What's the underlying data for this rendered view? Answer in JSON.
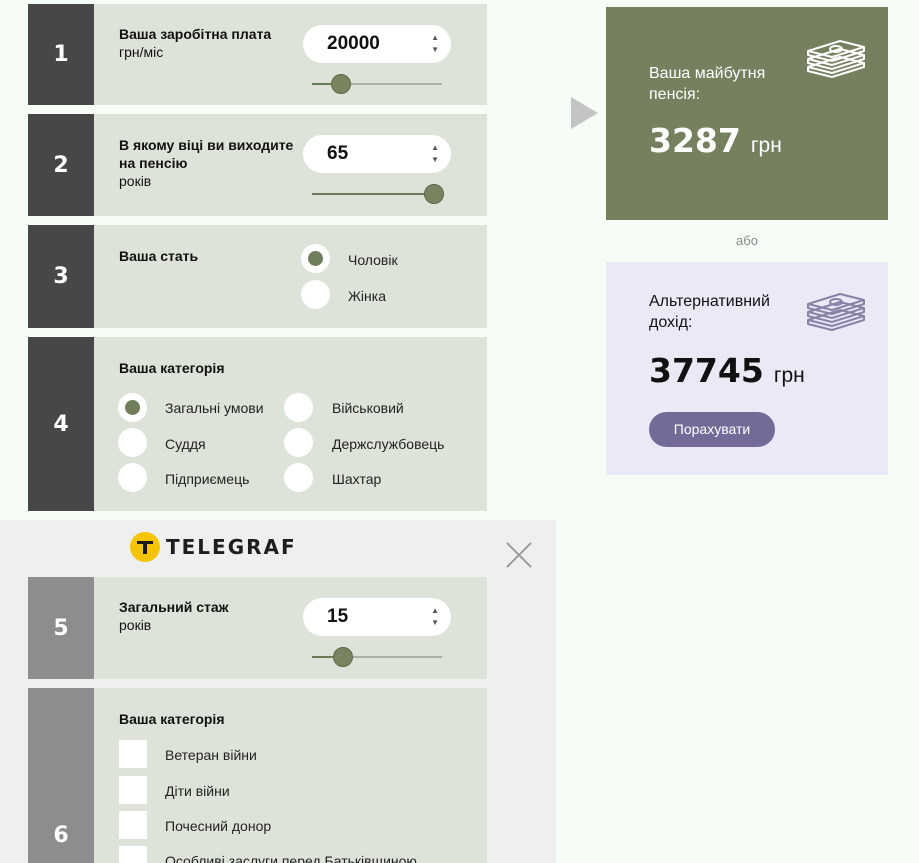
{
  "step1": {
    "num": "1",
    "title": "Ваша заробітна плата",
    "sub": "грн/міс",
    "value": "20000",
    "slider_fraction": 0.22
  },
  "step2": {
    "num": "2",
    "title_line1": "В якому віці ви виходите",
    "title_line2": "на пенсію",
    "sub": "років",
    "value": "65",
    "slider_fraction": 0.94
  },
  "step3": {
    "num": "3",
    "title": "Ваша стать",
    "options": [
      "Чоловік",
      "Жінка"
    ],
    "selected": "Чоловік"
  },
  "step4": {
    "num": "4",
    "title": "Ваша категорія",
    "options": [
      "Загальні умови",
      "Військовий",
      "Суддя",
      "Держслужбовець",
      "Підприємець",
      "Шахтар"
    ],
    "selected": "Загальні умови"
  },
  "result_main": {
    "label_line1": "Ваша майбутня",
    "label_line2": "пенсія:",
    "amount": "3287",
    "unit": "грн",
    "bg": "#74805e"
  },
  "or_text": "або",
  "result_alt": {
    "label_line1": "Альтернативний",
    "label_line2": "дохід:",
    "amount": "37745",
    "unit": "грн",
    "button": "Порахувати",
    "bg": "#eaeaf7"
  },
  "ad": {
    "logo_text": "TELEGRAF"
  },
  "step5": {
    "num": "5",
    "title": "Загальний стаж",
    "sub": "років",
    "value": "15",
    "slider_fraction": 0.24
  },
  "step6": {
    "num": "6",
    "title": "Ваша категорія",
    "options": [
      "Ветеран війни",
      "Діти війни",
      "Почесний донор",
      "Особливі заслуги перед Батьківщиною"
    ]
  }
}
